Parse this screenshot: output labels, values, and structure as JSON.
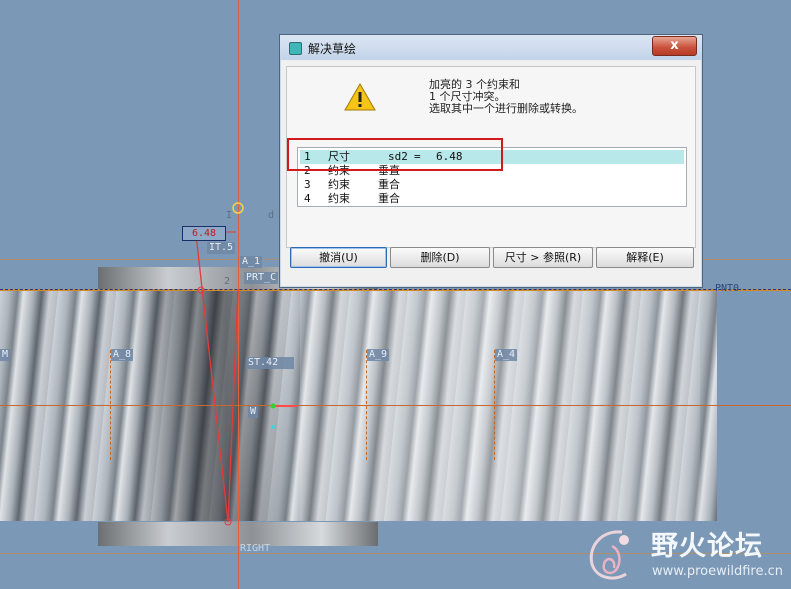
{
  "dialog": {
    "title": "解决草绘",
    "close_label": "x",
    "message_lines": [
      "加亮的 3 个约束和",
      "1 个尺寸冲突。",
      "选取其中一个进行删除或转换。"
    ],
    "items": [
      {
        "index": "1",
        "type": "尺寸",
        "name": "sd2",
        "op": "=",
        "value": "6.48",
        "selected": true
      },
      {
        "index": "2",
        "type": "约束",
        "name": "垂直",
        "op": "",
        "value": "",
        "selected": false
      },
      {
        "index": "3",
        "type": "约束",
        "name": "重合",
        "op": "",
        "value": "",
        "selected": false
      },
      {
        "index": "4",
        "type": "约束",
        "name": "重合",
        "op": "",
        "value": "",
        "selected": false
      }
    ],
    "buttons": {
      "undo": "撤消(U)",
      "delete": "删除(D)",
      "dim_to_ref": "尺寸 > 参照(R)",
      "explain": "解释(E)"
    },
    "highlight_color": "#d21a1a",
    "selection_color": "#b8e8ea"
  },
  "viewport": {
    "dimension_value": "6.48",
    "labels": {
      "it": "IT.5",
      "a1": "A_1",
      "prt": "PRT_C",
      "pnt": "PNT0",
      "a8": "A_8",
      "a9": "A_9",
      "a4": "A_4",
      "st42": "ST.42",
      "right": "RIGHT",
      "left_m": "M",
      "center_w": "W",
      "mark_i": "I",
      "mark_d": "d",
      "mark_2": "2"
    },
    "colors": {
      "background": "#7b98b7",
      "sketch_red": "#e23b3b",
      "datum_orange": "#d48a2a"
    }
  },
  "watermark": {
    "title": "野火论坛",
    "url": "www.proewildfire.cn"
  }
}
